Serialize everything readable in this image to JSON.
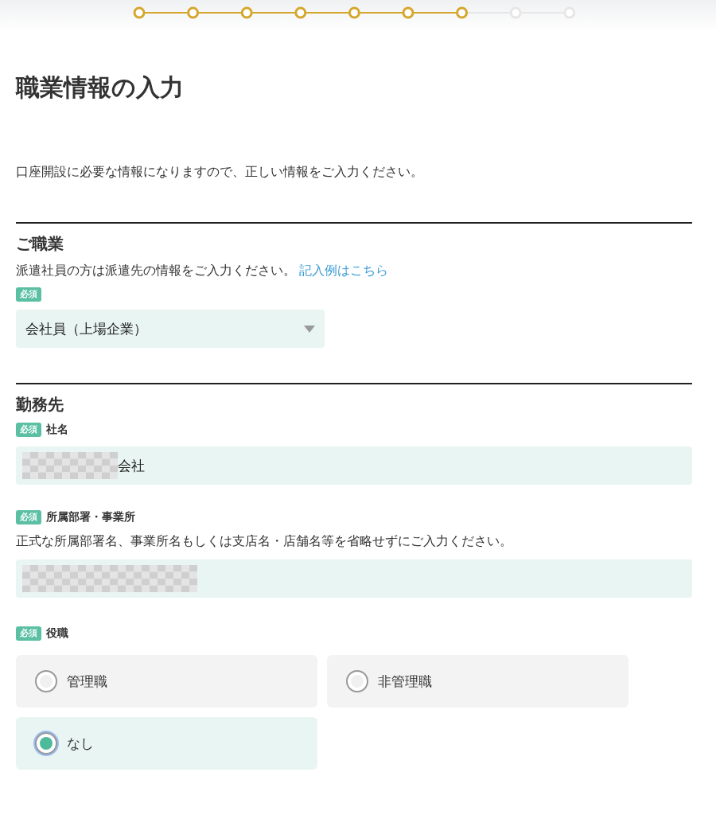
{
  "stepper": {
    "steps": [
      {
        "completed": true
      },
      {
        "completed": true
      },
      {
        "completed": true
      },
      {
        "completed": true
      },
      {
        "completed": true
      },
      {
        "completed": true
      },
      {
        "completed": true
      },
      {
        "completed": false
      },
      {
        "completed": false
      }
    ]
  },
  "title": "職業情報の入力",
  "intro": "口座開設に必要な情報になりますので、正しい情報をご入力ください。",
  "sections": [
    {
      "heading": "ご職業",
      "fields": [
        {
          "kind": "select",
          "note": "派遣社員の方は派遣先の情報をご入力ください。",
          "link": "記入例はこちら",
          "badge": "必須",
          "value": "会社員（上場企業）"
        }
      ]
    },
    {
      "heading": "勤務先",
      "fields": [
        {
          "kind": "text",
          "badge": "必須",
          "label": "社名",
          "redacted": true,
          "value": "会社"
        },
        {
          "kind": "text",
          "badge": "必須",
          "label": "所属部署・事業所",
          "note": "正式な所属部署名、事業所名もしくは支店名・店舗名等を省略せずにご入力ください。",
          "redacted": true
        },
        {
          "kind": "radio",
          "badge": "必須",
          "label": "役職",
          "options": [
            {
              "label": "管理職",
              "selected": false
            },
            {
              "label": "非管理職",
              "selected": false
            },
            {
              "label": "なし",
              "selected": true
            }
          ]
        }
      ]
    }
  ]
}
